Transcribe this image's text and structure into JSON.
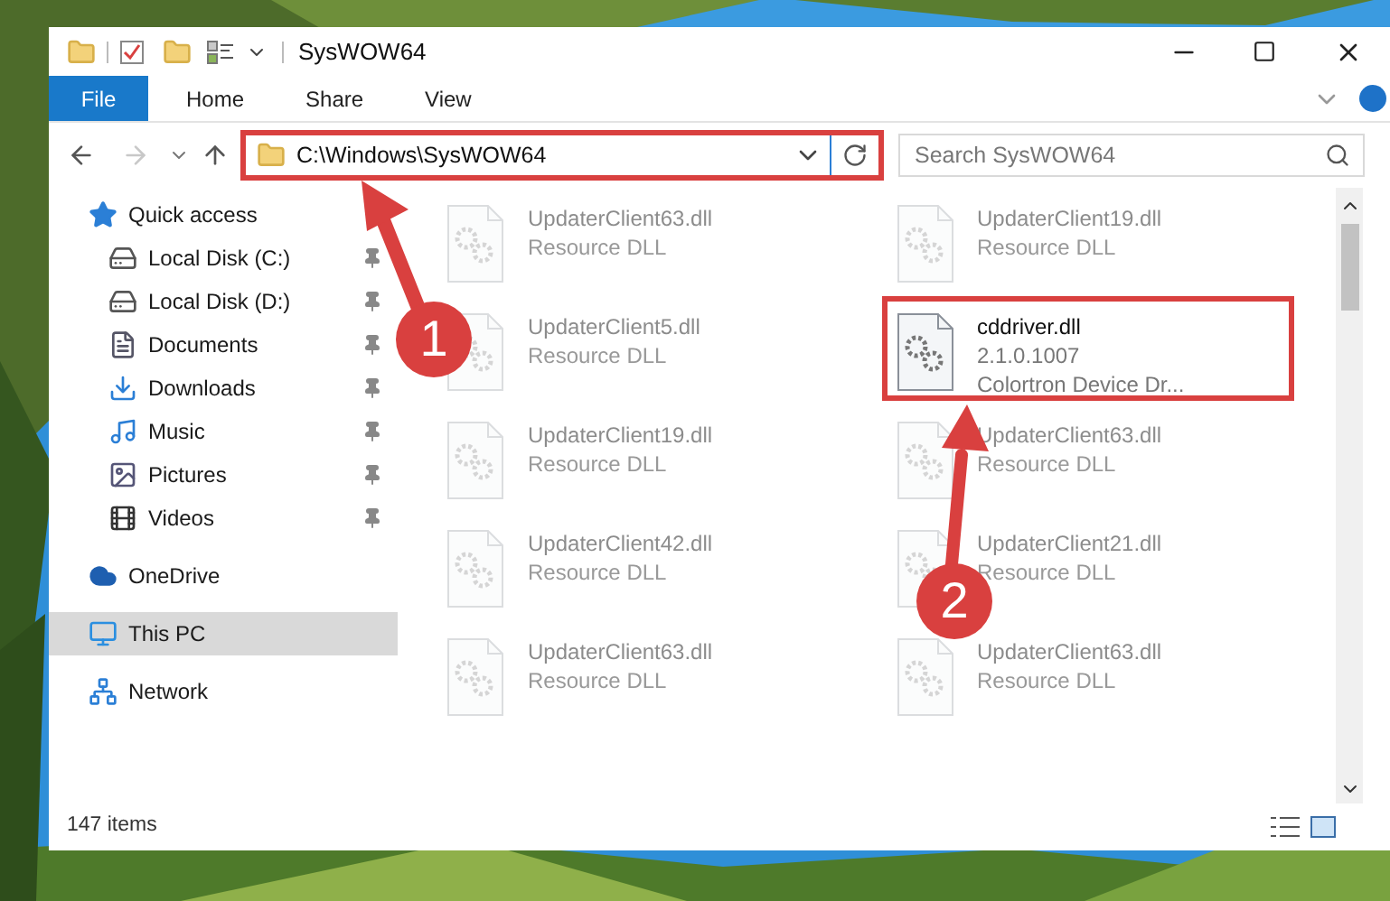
{
  "window": {
    "title": "SysWOW64"
  },
  "ribbon_tabs": [
    {
      "label": "File",
      "selected": true
    },
    {
      "label": "Home",
      "selected": false
    },
    {
      "label": "Share",
      "selected": false
    },
    {
      "label": "View",
      "selected": false
    }
  ],
  "address": {
    "value": "C:\\Windows\\SysWOW64",
    "highlighted": true
  },
  "search": {
    "placeholder": "Search SysWOW64"
  },
  "sidebar": {
    "items": [
      {
        "label": "Quick access",
        "kind": "quick",
        "selected": false,
        "children": [
          {
            "label": "Local Disk (C:)",
            "kind": "disk",
            "pinned": true,
            "selected": false
          },
          {
            "label": "Local Disk (D:)",
            "kind": "disk",
            "pinned": true,
            "selected": false
          },
          {
            "label": "Documents",
            "kind": "documents",
            "pinned": true,
            "selected": false
          },
          {
            "label": "Downloads",
            "kind": "downloads",
            "pinned": true,
            "selected": false
          },
          {
            "label": "Music",
            "kind": "music",
            "pinned": true,
            "selected": false
          },
          {
            "label": "Pictures",
            "kind": "pictures",
            "pinned": true,
            "selected": false
          },
          {
            "label": "Videos",
            "kind": "videos",
            "pinned": true,
            "selected": false
          }
        ]
      },
      {
        "label": "OneDrive",
        "kind": "onedrive",
        "selected": false
      },
      {
        "label": "This PC",
        "kind": "pc",
        "selected": true
      },
      {
        "label": "Network",
        "kind": "network",
        "selected": false
      }
    ]
  },
  "files": [
    {
      "name": "UpdaterClient63.dll",
      "lines": [
        "Resource DLL"
      ],
      "blurred": true,
      "highlighted": false
    },
    {
      "name": "UpdaterClient19.dll",
      "lines": [
        "Resource DLL"
      ],
      "blurred": true,
      "highlighted": false
    },
    {
      "name": "UpdaterClient5.dll",
      "lines": [
        "Resource DLL"
      ],
      "blurred": true,
      "highlighted": false
    },
    {
      "name": "cddriver.dll",
      "lines": [
        "2.1.0.1007",
        "Colortron Device Dr..."
      ],
      "blurred": false,
      "highlighted": true
    },
    {
      "name": "UpdaterClient19.dll",
      "lines": [
        "Resource DLL"
      ],
      "blurred": true,
      "highlighted": false
    },
    {
      "name": "UpdaterClient63.dll",
      "lines": [
        "Resource DLL"
      ],
      "blurred": true,
      "highlighted": false
    },
    {
      "name": "UpdaterClient42.dll",
      "lines": [
        "Resource DLL"
      ],
      "blurred": true,
      "highlighted": false
    },
    {
      "name": "UpdaterClient21.dll",
      "lines": [
        "Resource DLL"
      ],
      "blurred": true,
      "highlighted": false
    },
    {
      "name": "UpdaterClient63.dll",
      "lines": [
        "Resource DLL"
      ],
      "blurred": true,
      "highlighted": false
    },
    {
      "name": "UpdaterClient63.dll",
      "lines": [
        "Resource DLL"
      ],
      "blurred": true,
      "highlighted": false
    }
  ],
  "status_bar": {
    "count": "147 items"
  },
  "annotations": [
    {
      "number": "1"
    },
    {
      "number": "2"
    }
  ]
}
